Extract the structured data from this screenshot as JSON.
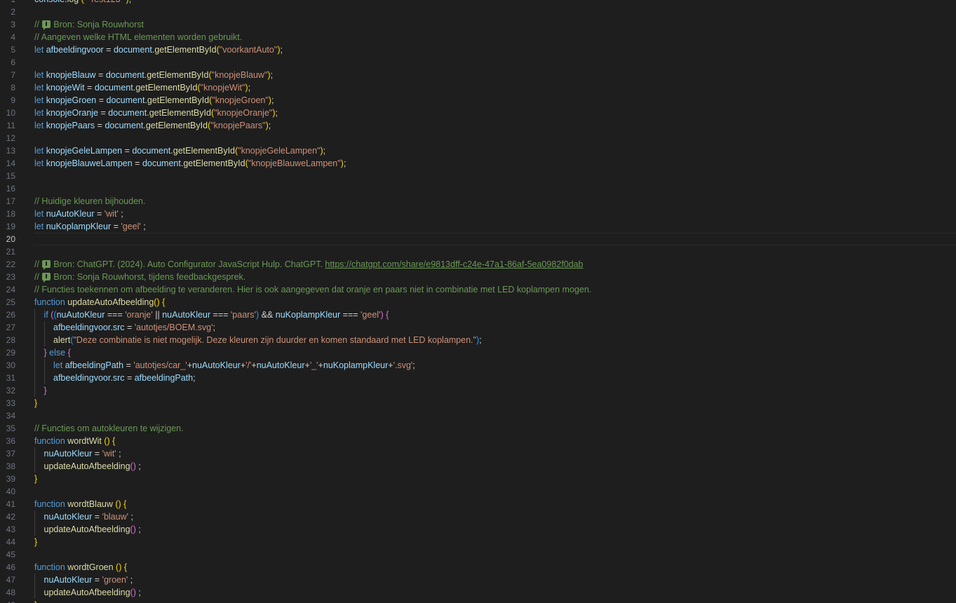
{
  "editor": {
    "current_line": 20,
    "lines": [
      {
        "n": "1",
        "indent": 0,
        "tokens": [
          [
            "console",
            "variable"
          ],
          [
            ".",
            "punct"
          ],
          [
            "log",
            "function"
          ],
          [
            " (",
            "bracket1"
          ],
          [
            " \"Test123\" ",
            "string"
          ],
          [
            ")",
            "bracket1"
          ],
          [
            ";",
            "punct"
          ]
        ]
      },
      {
        "n": "2",
        "indent": 0,
        "tokens": []
      },
      {
        "n": "3",
        "indent": 0,
        "tokens": [
          [
            "// ",
            "comment"
          ],
          [
            "",
            "badge"
          ],
          [
            "Bron: Sonja Rouwhorst",
            "comment"
          ]
        ]
      },
      {
        "n": "4",
        "indent": 0,
        "tokens": [
          [
            "// Aangeven welke HTML elementen worden gebruikt.",
            "comment"
          ]
        ]
      },
      {
        "n": "5",
        "indent": 0,
        "tokens": [
          [
            "let ",
            "keyword"
          ],
          [
            "afbeeldingvoor",
            "variable"
          ],
          [
            " = ",
            "punct"
          ],
          [
            "document",
            "variable"
          ],
          [
            ".",
            "punct"
          ],
          [
            "getElementById",
            "function"
          ],
          [
            "(",
            "bracket1"
          ],
          [
            "\"voorkantAuto\"",
            "string"
          ],
          [
            ")",
            "bracket1"
          ],
          [
            ";",
            "punct"
          ]
        ]
      },
      {
        "n": "6",
        "indent": 0,
        "tokens": []
      },
      {
        "n": "7",
        "indent": 0,
        "tokens": [
          [
            "let ",
            "keyword"
          ],
          [
            "knopjeBlauw",
            "variable"
          ],
          [
            " = ",
            "punct"
          ],
          [
            "document",
            "variable"
          ],
          [
            ".",
            "punct"
          ],
          [
            "getElementById",
            "function"
          ],
          [
            "(",
            "bracket1"
          ],
          [
            "\"knopjeBlauw\"",
            "string"
          ],
          [
            ")",
            "bracket1"
          ],
          [
            ";",
            "punct"
          ]
        ]
      },
      {
        "n": "8",
        "indent": 0,
        "tokens": [
          [
            "let ",
            "keyword"
          ],
          [
            "knopjeWit",
            "variable"
          ],
          [
            " = ",
            "punct"
          ],
          [
            "document",
            "variable"
          ],
          [
            ".",
            "punct"
          ],
          [
            "getElementById",
            "function"
          ],
          [
            "(",
            "bracket1"
          ],
          [
            "\"knopjeWit\"",
            "string"
          ],
          [
            ")",
            "bracket1"
          ],
          [
            ";",
            "punct"
          ]
        ]
      },
      {
        "n": "9",
        "indent": 0,
        "tokens": [
          [
            "let ",
            "keyword"
          ],
          [
            "knopjeGroen",
            "variable"
          ],
          [
            " = ",
            "punct"
          ],
          [
            "document",
            "variable"
          ],
          [
            ".",
            "punct"
          ],
          [
            "getElementById",
            "function"
          ],
          [
            "(",
            "bracket1"
          ],
          [
            "\"knopjeGroen\"",
            "string"
          ],
          [
            ")",
            "bracket1"
          ],
          [
            ";",
            "punct"
          ]
        ]
      },
      {
        "n": "10",
        "indent": 0,
        "tokens": [
          [
            "let ",
            "keyword"
          ],
          [
            "knopjeOranje",
            "variable"
          ],
          [
            " = ",
            "punct"
          ],
          [
            "document",
            "variable"
          ],
          [
            ".",
            "punct"
          ],
          [
            "getElementById",
            "function"
          ],
          [
            "(",
            "bracket1"
          ],
          [
            "\"knopjeOranje\"",
            "string"
          ],
          [
            ")",
            "bracket1"
          ],
          [
            ";",
            "punct"
          ]
        ]
      },
      {
        "n": "11",
        "indent": 0,
        "tokens": [
          [
            "let ",
            "keyword"
          ],
          [
            "knopjePaars",
            "variable"
          ],
          [
            " = ",
            "punct"
          ],
          [
            "document",
            "variable"
          ],
          [
            ".",
            "punct"
          ],
          [
            "getElementById",
            "function"
          ],
          [
            "(",
            "bracket1"
          ],
          [
            "\"knopjePaars\"",
            "string"
          ],
          [
            ")",
            "bracket1"
          ],
          [
            ";",
            "punct"
          ]
        ]
      },
      {
        "n": "12",
        "indent": 0,
        "tokens": []
      },
      {
        "n": "13",
        "indent": 0,
        "tokens": [
          [
            "let ",
            "keyword"
          ],
          [
            "knopjeGeleLampen",
            "variable"
          ],
          [
            " = ",
            "punct"
          ],
          [
            "document",
            "variable"
          ],
          [
            ".",
            "punct"
          ],
          [
            "getElementById",
            "function"
          ],
          [
            "(",
            "bracket1"
          ],
          [
            "\"knopjeGeleLampen\"",
            "string"
          ],
          [
            ")",
            "bracket1"
          ],
          [
            ";",
            "punct"
          ]
        ]
      },
      {
        "n": "14",
        "indent": 0,
        "tokens": [
          [
            "let ",
            "keyword"
          ],
          [
            "knopjeBlauweLampen",
            "variable"
          ],
          [
            " = ",
            "punct"
          ],
          [
            "document",
            "variable"
          ],
          [
            ".",
            "punct"
          ],
          [
            "getElementById",
            "function"
          ],
          [
            "(",
            "bracket1"
          ],
          [
            "\"knopjeBlauweLampen\"",
            "string"
          ],
          [
            ")",
            "bracket1"
          ],
          [
            ";",
            "punct"
          ]
        ]
      },
      {
        "n": "15",
        "indent": 0,
        "tokens": []
      },
      {
        "n": "16",
        "indent": 0,
        "tokens": []
      },
      {
        "n": "17",
        "indent": 0,
        "tokens": [
          [
            "// Huidige kleuren bijhouden.",
            "comment"
          ]
        ]
      },
      {
        "n": "18",
        "indent": 0,
        "tokens": [
          [
            "let ",
            "keyword"
          ],
          [
            "nuAutoKleur",
            "variable"
          ],
          [
            " = ",
            "punct"
          ],
          [
            "'wit'",
            "string"
          ],
          [
            " ;",
            "punct"
          ]
        ]
      },
      {
        "n": "19",
        "indent": 0,
        "tokens": [
          [
            "let ",
            "keyword"
          ],
          [
            "nuKoplampKleur",
            "variable"
          ],
          [
            " = ",
            "punct"
          ],
          [
            "'geel'",
            "string"
          ],
          [
            " ;",
            "punct"
          ]
        ]
      },
      {
        "n": "20",
        "indent": 0,
        "tokens": []
      },
      {
        "n": "21",
        "indent": 0,
        "tokens": []
      },
      {
        "n": "22",
        "indent": 0,
        "tokens": [
          [
            "// ",
            "comment"
          ],
          [
            "",
            "badge"
          ],
          [
            "Bron: ChatGPT. (2024). Auto Configurator JavaScript Hulp. ChatGPT. ",
            "comment"
          ],
          [
            "https://chatgpt.com/share/e9813dff-c24e-47a1-86af-5ea0982f0dab",
            "link"
          ]
        ]
      },
      {
        "n": "23",
        "indent": 0,
        "tokens": [
          [
            "// ",
            "comment"
          ],
          [
            "",
            "badge"
          ],
          [
            "Bron: Sonja Rouwhorst, tijdens feedbackgesprek.",
            "comment"
          ]
        ]
      },
      {
        "n": "24",
        "indent": 0,
        "tokens": [
          [
            "// Functies toekennen om afbeelding te veranderen. Hier is ook aangegeven dat oranje en paars niet in combinatie met LED koplampen mogen.",
            "comment"
          ]
        ]
      },
      {
        "n": "25",
        "indent": 0,
        "tokens": [
          [
            "function ",
            "keyword"
          ],
          [
            "updateAutoAfbeelding",
            "function"
          ],
          [
            "()",
            "bracket1"
          ],
          [
            " ",
            "punct"
          ],
          [
            "{",
            "bracket1"
          ]
        ]
      },
      {
        "n": "26",
        "indent": 1,
        "tokens": [
          [
            "if ",
            "keyword"
          ],
          [
            "(",
            "bracket2"
          ],
          [
            "(",
            "bracket3"
          ],
          [
            "nuAutoKleur",
            "variable"
          ],
          [
            " === ",
            "punct"
          ],
          [
            "'oranje'",
            "string"
          ],
          [
            " || ",
            "punct"
          ],
          [
            "nuAutoKleur",
            "variable"
          ],
          [
            " === ",
            "punct"
          ],
          [
            "'paars'",
            "string"
          ],
          [
            ")",
            "bracket3"
          ],
          [
            " && ",
            "punct"
          ],
          [
            "nuKoplampKleur",
            "variable"
          ],
          [
            " === ",
            "punct"
          ],
          [
            "'geel'",
            "string"
          ],
          [
            ")",
            "bracket2"
          ],
          [
            " {",
            "bracket2"
          ]
        ]
      },
      {
        "n": "27",
        "indent": 2,
        "tokens": [
          [
            "afbeeldingvoor",
            "variable"
          ],
          [
            ".",
            "punct"
          ],
          [
            "src",
            "variable"
          ],
          [
            " = ",
            "punct"
          ],
          [
            "'autotjes/BOEM.svg'",
            "string"
          ],
          [
            ";",
            "punct"
          ]
        ]
      },
      {
        "n": "28",
        "indent": 2,
        "tokens": [
          [
            "alert",
            "function"
          ],
          [
            "(",
            "bracket3"
          ],
          [
            "\"Deze combinatie is niet mogelijk. Deze kleuren zijn duurder en komen standaard met LED koplampen.\"",
            "string"
          ],
          [
            ")",
            "bracket3"
          ],
          [
            ";",
            "punct"
          ]
        ]
      },
      {
        "n": "29",
        "indent": 1,
        "tokens": [
          [
            "} ",
            "bracket2"
          ],
          [
            "else ",
            "keyword"
          ],
          [
            "{",
            "bracket2"
          ]
        ]
      },
      {
        "n": "30",
        "indent": 2,
        "tokens": [
          [
            "let ",
            "keyword"
          ],
          [
            "afbeeldingPath",
            "variable"
          ],
          [
            " = ",
            "punct"
          ],
          [
            "'autotjes/car_'",
            "string"
          ],
          [
            "+",
            "punct"
          ],
          [
            "nuAutoKleur",
            "variable"
          ],
          [
            "+",
            "punct"
          ],
          [
            "'/'",
            "string"
          ],
          [
            "+",
            "punct"
          ],
          [
            "nuAutoKleur",
            "variable"
          ],
          [
            "+",
            "punct"
          ],
          [
            "'_'",
            "string"
          ],
          [
            "+",
            "punct"
          ],
          [
            "nuKoplampKleur",
            "variable"
          ],
          [
            "+",
            "punct"
          ],
          [
            "'.svg'",
            "string"
          ],
          [
            ";",
            "punct"
          ]
        ]
      },
      {
        "n": "31",
        "indent": 2,
        "tokens": [
          [
            "afbeeldingvoor",
            "variable"
          ],
          [
            ".",
            "punct"
          ],
          [
            "src",
            "variable"
          ],
          [
            " = ",
            "punct"
          ],
          [
            "afbeeldingPath",
            "variable"
          ],
          [
            ";",
            "punct"
          ]
        ]
      },
      {
        "n": "32",
        "indent": 1,
        "tokens": [
          [
            "}",
            "bracket2"
          ]
        ]
      },
      {
        "n": "33",
        "indent": 0,
        "tokens": [
          [
            "}",
            "bracket1"
          ]
        ]
      },
      {
        "n": "34",
        "indent": 0,
        "tokens": []
      },
      {
        "n": "35",
        "indent": 0,
        "tokens": [
          [
            "// Functies om autokleuren te wijzigen.",
            "comment"
          ]
        ]
      },
      {
        "n": "36",
        "indent": 0,
        "tokens": [
          [
            "function ",
            "keyword"
          ],
          [
            "wordtWit",
            "function"
          ],
          [
            " ()",
            "bracket1"
          ],
          [
            " {",
            "bracket1"
          ]
        ]
      },
      {
        "n": "37",
        "indent": 1,
        "tokens": [
          [
            "nuAutoKleur",
            "variable"
          ],
          [
            " = ",
            "punct"
          ],
          [
            "'wit'",
            "string"
          ],
          [
            " ;",
            "punct"
          ]
        ]
      },
      {
        "n": "38",
        "indent": 1,
        "tokens": [
          [
            "updateAutoAfbeelding",
            "function"
          ],
          [
            "()",
            "bracket2"
          ],
          [
            " ;",
            "punct"
          ]
        ]
      },
      {
        "n": "39",
        "indent": 0,
        "tokens": [
          [
            "}",
            "bracket1"
          ]
        ]
      },
      {
        "n": "40",
        "indent": 0,
        "tokens": []
      },
      {
        "n": "41",
        "indent": 0,
        "tokens": [
          [
            "function ",
            "keyword"
          ],
          [
            "wordtBlauw",
            "function"
          ],
          [
            " ()",
            "bracket1"
          ],
          [
            " {",
            "bracket1"
          ]
        ]
      },
      {
        "n": "42",
        "indent": 1,
        "tokens": [
          [
            "nuAutoKleur",
            "variable"
          ],
          [
            " = ",
            "punct"
          ],
          [
            "'blauw'",
            "string"
          ],
          [
            " ;",
            "punct"
          ]
        ]
      },
      {
        "n": "43",
        "indent": 1,
        "tokens": [
          [
            "updateAutoAfbeelding",
            "function"
          ],
          [
            "()",
            "bracket2"
          ],
          [
            " ;",
            "punct"
          ]
        ]
      },
      {
        "n": "44",
        "indent": 0,
        "tokens": [
          [
            "}",
            "bracket1"
          ]
        ]
      },
      {
        "n": "45",
        "indent": 0,
        "tokens": []
      },
      {
        "n": "46",
        "indent": 0,
        "tokens": [
          [
            "function ",
            "keyword"
          ],
          [
            "wordtGroen",
            "function"
          ],
          [
            " ()",
            "bracket1"
          ],
          [
            " {",
            "bracket1"
          ]
        ]
      },
      {
        "n": "47",
        "indent": 1,
        "tokens": [
          [
            "nuAutoKleur",
            "variable"
          ],
          [
            " = ",
            "punct"
          ],
          [
            "'groen'",
            "string"
          ],
          [
            " ;",
            "punct"
          ]
        ]
      },
      {
        "n": "48",
        "indent": 1,
        "tokens": [
          [
            "updateAutoAfbeelding",
            "function"
          ],
          [
            "()",
            "bracket2"
          ],
          [
            " ;",
            "punct"
          ]
        ]
      },
      {
        "n": "49",
        "indent": 0,
        "tokens": [
          [
            "}",
            "bracket1"
          ]
        ]
      }
    ]
  }
}
